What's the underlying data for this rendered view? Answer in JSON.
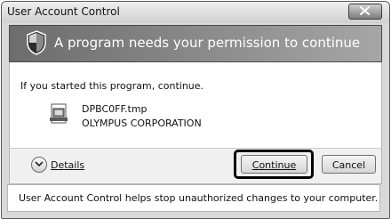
{
  "window": {
    "title": "User Account Control",
    "close_icon": "close-icon"
  },
  "banner": {
    "icon": "shield-icon",
    "text": "A program needs your permission to continue"
  },
  "content": {
    "instruction": "If you started this program, continue.",
    "program_icon": "program-file-icon",
    "program_name": "DPBC0FF.tmp",
    "publisher": "OLYMPUS CORPORATION"
  },
  "footer": {
    "details_icon": "chevron-down-icon",
    "details_label": "Details",
    "continue_label": "Continue",
    "cancel_label": "Cancel"
  },
  "bottom": {
    "info_text": "User Account Control helps stop unauthorized changes to your computer."
  },
  "colors": {
    "banner_dark": "#6c6c6c",
    "banner_light": "#a6a6a6",
    "focus_ring": "#000000"
  }
}
